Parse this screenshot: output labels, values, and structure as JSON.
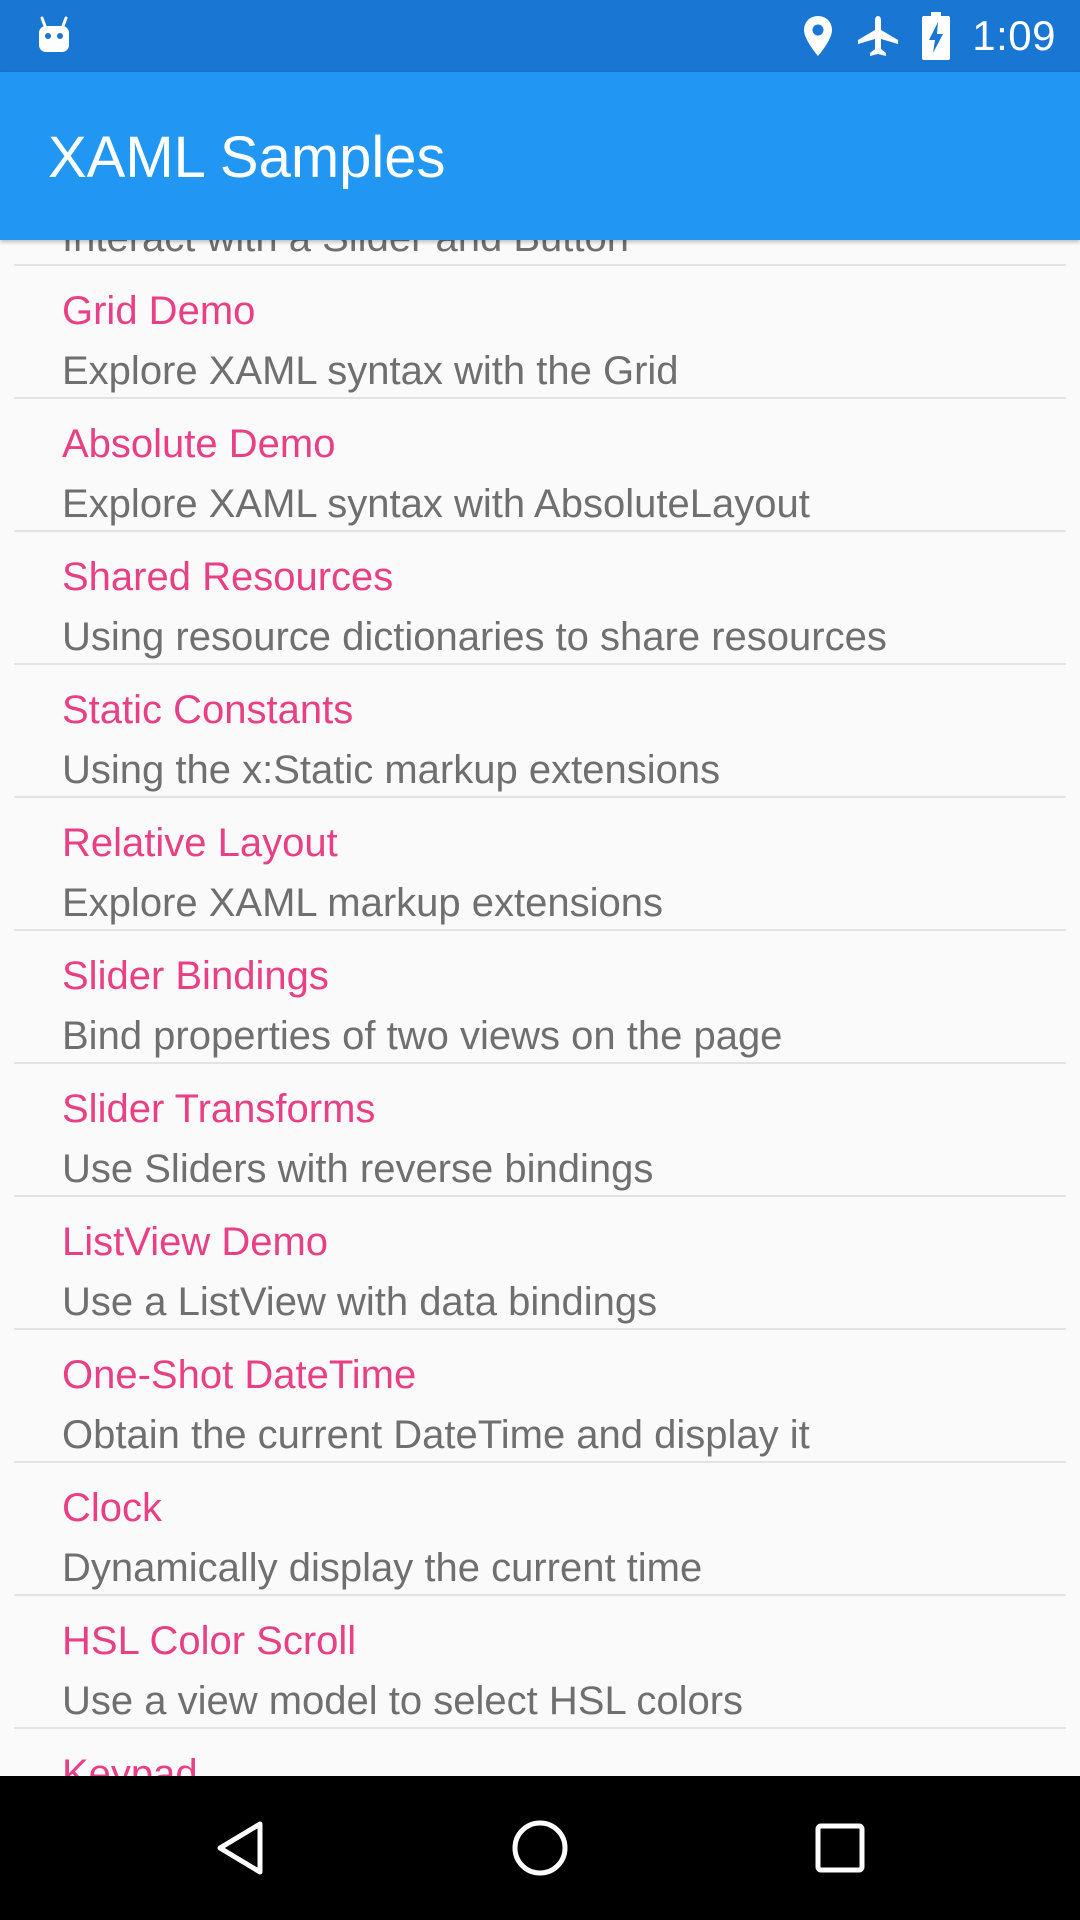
{
  "status_bar": {
    "time": "1:09",
    "icons": [
      "android-robot-icon",
      "location-icon",
      "airplane-mode-icon",
      "battery-charging-icon"
    ],
    "background": "#1976d2"
  },
  "app_bar": {
    "title": "XAML Samples",
    "background": "#2196f3"
  },
  "colors": {
    "item_title": "#e83f85",
    "item_detail": "#6f6f6f",
    "divider": "#e3e3e3"
  },
  "list": {
    "items": [
      {
        "title": "",
        "detail": "Interact with a Slider and Button"
      },
      {
        "title": "Grid Demo",
        "detail": "Explore XAML syntax with the Grid"
      },
      {
        "title": "Absolute Demo",
        "detail": "Explore XAML syntax with AbsoluteLayout"
      },
      {
        "title": "Shared Resources",
        "detail": "Using resource dictionaries to share resources"
      },
      {
        "title": "Static Constants",
        "detail": "Using the x:Static markup extensions"
      },
      {
        "title": "Relative Layout",
        "detail": "Explore XAML markup extensions"
      },
      {
        "title": "Slider Bindings",
        "detail": "Bind properties of two views on the page"
      },
      {
        "title": "Slider Transforms",
        "detail": "Use Sliders with reverse bindings"
      },
      {
        "title": "ListView Demo",
        "detail": "Use a ListView with data bindings"
      },
      {
        "title": "One-Shot DateTime",
        "detail": "Obtain the current DateTime and display it"
      },
      {
        "title": "Clock",
        "detail": "Dynamically display the current time"
      },
      {
        "title": "HSL Color Scroll",
        "detail": "Use a view model to select HSL colors"
      },
      {
        "title": "Keypad",
        "detail": ""
      }
    ]
  },
  "nav_bar": {
    "buttons": [
      "back-icon",
      "home-icon",
      "recents-icon"
    ]
  }
}
